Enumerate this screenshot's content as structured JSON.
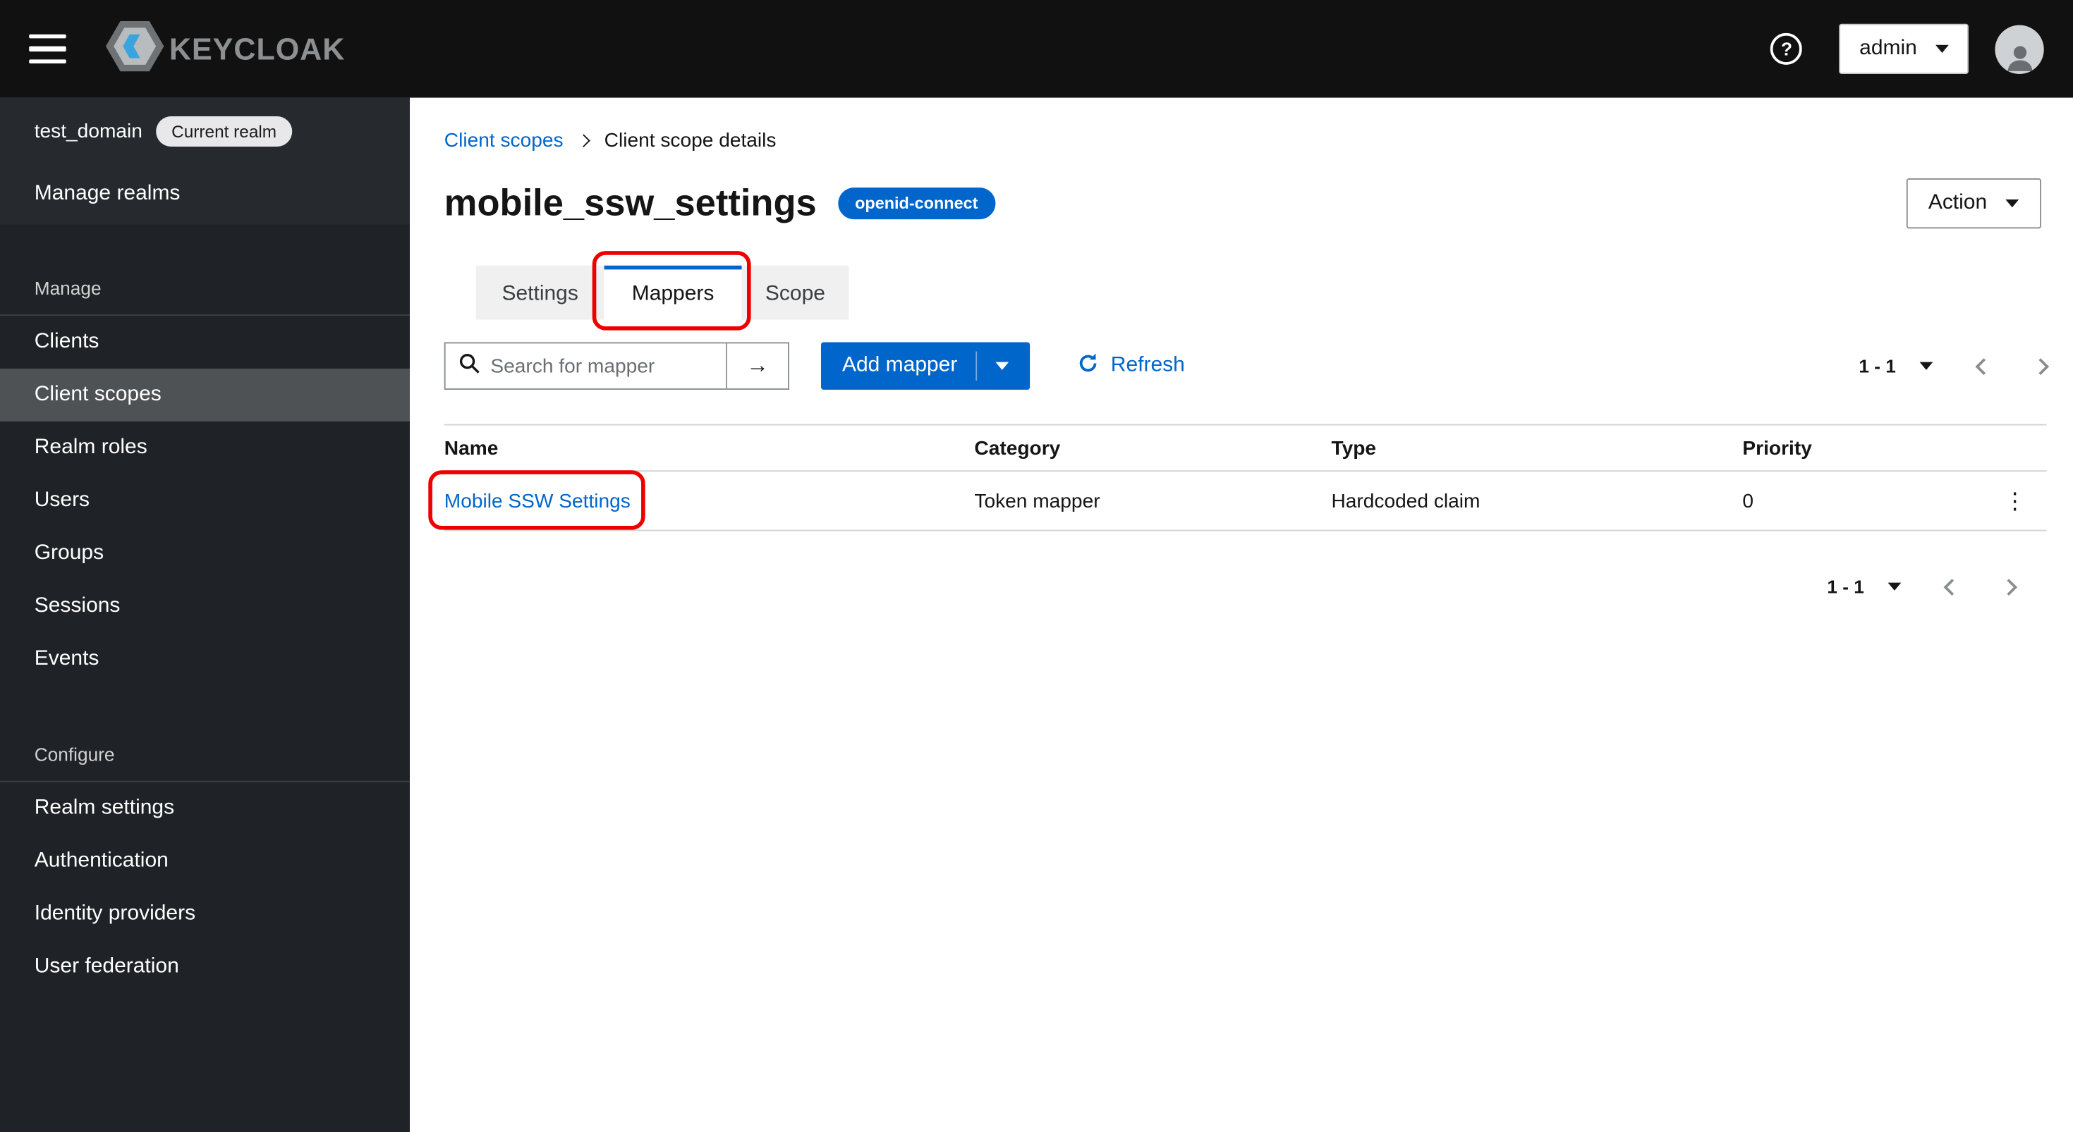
{
  "masthead": {
    "brand": "KEYCLOAK",
    "user_menu": {
      "label": "admin"
    }
  },
  "sidebar": {
    "realm_name": "test_domain",
    "realm_badge": "Current realm",
    "manage_realms_label": "Manage realms",
    "groups": [
      {
        "label": "Manage",
        "items": [
          {
            "label": "Clients"
          },
          {
            "label": "Client scopes",
            "active": true
          },
          {
            "label": "Realm roles"
          },
          {
            "label": "Users"
          },
          {
            "label": "Groups"
          },
          {
            "label": "Sessions"
          },
          {
            "label": "Events"
          }
        ]
      },
      {
        "label": "Configure",
        "items": [
          {
            "label": "Realm settings"
          },
          {
            "label": "Authentication"
          },
          {
            "label": "Identity providers"
          },
          {
            "label": "User federation"
          }
        ]
      }
    ]
  },
  "breadcrumb": {
    "parent": "Client scopes",
    "current": "Client scope details"
  },
  "page": {
    "title": "mobile_ssw_settings",
    "protocol_badge": "openid-connect",
    "action_button": "Action"
  },
  "tabs": [
    {
      "label": "Settings"
    },
    {
      "label": "Mappers",
      "active": true
    },
    {
      "label": "Scope"
    }
  ],
  "toolbar": {
    "search_placeholder": "Search for mapper",
    "add_mapper_button": "Add mapper",
    "refresh_label": "Refresh",
    "pagination_range": "1 - 1"
  },
  "mappers_table": {
    "columns": [
      "Name",
      "Category",
      "Type",
      "Priority"
    ],
    "rows": [
      {
        "name": "Mobile SSW Settings",
        "category": "Token mapper",
        "type": "Hardcoded claim",
        "priority": "0"
      }
    ]
  },
  "icons": {
    "arrow_right": "→",
    "kebab": "⋮"
  },
  "annotations": {
    "color": "#ee0000",
    "boxes": [
      "mappers-tab-highlight",
      "mapper-name-link-highlight"
    ]
  },
  "colors": {
    "link_blue": "#0066cc",
    "primary_blue": "#0066cc",
    "masthead_bg": "#111111",
    "sidebar_bg": "#1f2226",
    "active_nav_bg": "#4f5255",
    "annotation_red": "#ee0000"
  }
}
